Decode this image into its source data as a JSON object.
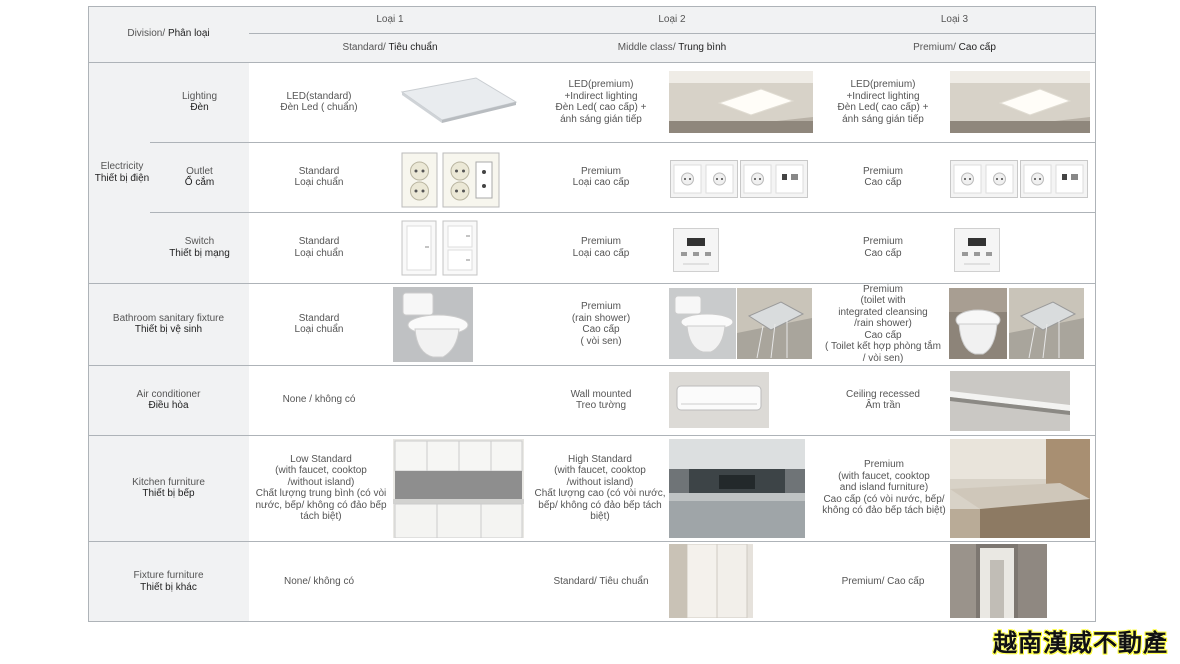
{
  "header": {
    "division": {
      "en": "Division",
      "vi": "Phân loại"
    },
    "types": [
      {
        "type": "Loại 1",
        "en": "Standard",
        "vi": "Tiêu chuẩn"
      },
      {
        "type": "Loại 2",
        "en": "Middle class",
        "vi": "Trung bình"
      },
      {
        "type": "Loại 3",
        "en": "Premium",
        "vi": "Cao cấp"
      }
    ]
  },
  "groups": {
    "electricity": {
      "en": "Electricity",
      "vi": "Thiết bị điện"
    }
  },
  "rows": [
    {
      "id": "lighting",
      "label_en": "Lighting",
      "label_vi": "Đèn",
      "l1": [
        "LED(standard)",
        "Đèn Led ( chuẩn)"
      ],
      "l2": [
        "LED(premium)",
        "+Indirect lighting",
        "Đèn Led( cao cấp) +",
        "ánh sáng gián tiếp"
      ],
      "l3": [
        "LED(premium)",
        "+Indirect lighting",
        "Đèn Led( cao cấp) +",
        "ánh sáng gián tiếp"
      ]
    },
    {
      "id": "outlet",
      "label_en": "Outlet",
      "label_vi": "Ổ cắm",
      "l1": [
        "Standard",
        "Loại chuẩn"
      ],
      "l2": [
        "Premium",
        "Loại cao cấp"
      ],
      "l3": [
        "Premium",
        "Cao cấp"
      ]
    },
    {
      "id": "switch",
      "label_en": "Switch",
      "label_vi": "Thiết bị mạng",
      "l1": [
        "Standard",
        "Loại chuẩn"
      ],
      "l2": [
        "Premium",
        "Loại cao cấp"
      ],
      "l3": [
        "Premium",
        "Cao cấp"
      ]
    },
    {
      "id": "bathroom",
      "label_en": "Bathroom sanitary fixture",
      "label_vi": "Thiết bị vệ sinh",
      "l1": [
        "Standard",
        "Loại chuẩn"
      ],
      "l2": [
        "Premium",
        "(rain shower)",
        "Cao cấp",
        "( vòi sen)"
      ],
      "l3": [
        "Premium",
        "(toilet with",
        "integrated cleansing",
        "/rain shower)",
        "Cao cấp",
        "( Toilet kết hợp phòng tắm",
        "/ vòi sen)"
      ]
    },
    {
      "id": "aircon",
      "label_en": "Air conditioner",
      "label_vi": "Điều hòa",
      "l1": [
        "None / không có"
      ],
      "l2": [
        "Wall mounted",
        "Treo tường"
      ],
      "l3": [
        "Ceiling recessed",
        "Âm trần"
      ]
    },
    {
      "id": "kitchen",
      "label_en": "Kitchen furniture",
      "label_vi": "Thiết bị bếp",
      "l1": [
        "Low Standard",
        "(with faucet, cooktop",
        "/without island)",
        "Chất lượng trung bình (có vòi",
        "nước, bếp/ không có đảo bếp",
        "tách biệt)"
      ],
      "l2": [
        "High Standard",
        "(with faucet, cooktop",
        "/without island)",
        "Chất lượng cao (có vòi nước,",
        "bếp/ không có đảo bếp tách",
        "biệt)"
      ],
      "l3": [
        "Premium",
        "(with faucet, cooktop",
        "and island furniture)",
        "Cao cấp (có vòi nước, bếp/",
        "không có đảo bếp tách biệt)"
      ]
    },
    {
      "id": "fixture",
      "label_en": "Fixture furniture",
      "label_vi": "Thiết bị khác",
      "l1": [
        "None/ không có"
      ],
      "l2": [
        "Standard/ Tiêu chuẩn"
      ],
      "l3": [
        "Premium/ Cao cấp"
      ]
    }
  ],
  "watermark": "越南漢威不動產",
  "colors": {
    "header_bg": "#f1f2f3",
    "grid": "#aeb3b8",
    "text_en": "#555555",
    "text_vi": "#222222"
  }
}
